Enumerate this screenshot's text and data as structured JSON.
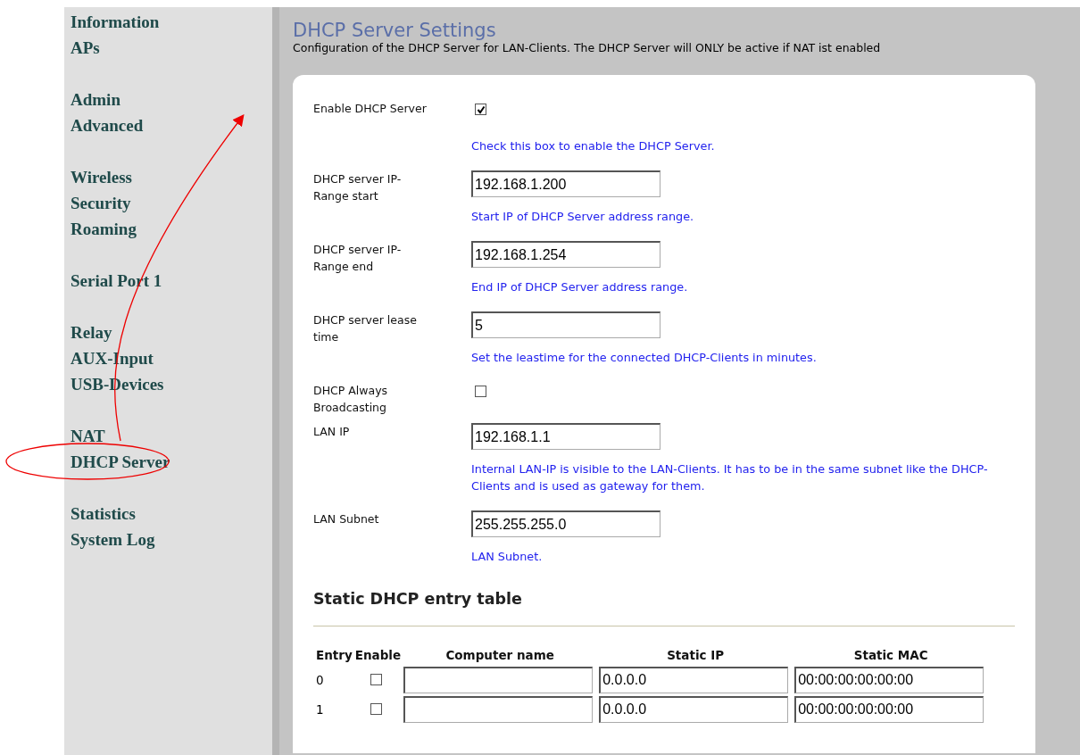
{
  "sidebar": {
    "groups": [
      {
        "items": [
          {
            "label": "Information"
          },
          {
            "label": "APs"
          }
        ]
      },
      {
        "items": [
          {
            "label": "Admin"
          },
          {
            "label": "Advanced"
          }
        ]
      },
      {
        "items": [
          {
            "label": "Wireless"
          },
          {
            "label": "Security"
          },
          {
            "label": "Roaming"
          }
        ]
      },
      {
        "items": [
          {
            "label": "Serial Port 1"
          }
        ]
      },
      {
        "items": [
          {
            "label": "Relay"
          },
          {
            "label": "AUX-Input"
          },
          {
            "label": "USB-Devices"
          }
        ]
      },
      {
        "items": [
          {
            "label": "NAT"
          },
          {
            "label": "DHCP Server"
          }
        ]
      },
      {
        "items": [
          {
            "label": "Statistics"
          },
          {
            "label": "System Log"
          }
        ]
      }
    ]
  },
  "page": {
    "title": "DHCP Server Settings",
    "description": "Configuration of the DHCP Server for LAN-Clients. The DHCP Server will ONLY be active if NAT ist enabled"
  },
  "settings": [
    {
      "kind": "checkbox",
      "label": "Enable DHCP Server",
      "checked": true,
      "hint": "Check this box to enable the DHCP Server."
    },
    {
      "kind": "text",
      "label": "DHCP server IP-Range start",
      "value": "192.168.1.200",
      "hint": "Start IP of DHCP Server address range."
    },
    {
      "kind": "text",
      "label": "DHCP server IP-Range end",
      "value": "192.168.1.254",
      "hint": "End IP of DHCP Server address range."
    },
    {
      "kind": "text",
      "label": "DHCP server lease time",
      "value": "5",
      "hint": "Set the leastime for the connected DHCP-Clients in minutes."
    },
    {
      "kind": "checkbox",
      "label": "DHCP Always Broadcasting",
      "checked": false
    },
    {
      "kind": "text",
      "label": "LAN IP",
      "value": "192.168.1.1",
      "hint": "Internal LAN-IP is visible to the LAN-Clients. It has to be in the same subnet like the DHCP-Clients and is used as gateway for them."
    },
    {
      "kind": "text",
      "label": "LAN Subnet",
      "value": "255.255.255.0",
      "hint": "LAN Subnet."
    }
  ],
  "static_table": {
    "title": "Static DHCP entry table",
    "columns": [
      "Entry",
      "Enable",
      "Computer name",
      "Static IP",
      "Static MAC"
    ],
    "rows": [
      {
        "entry": "0",
        "enabled": false,
        "static_ip": "0.0.0.0",
        "static_mac": "00:00:00:00:00:00"
      },
      {
        "entry": "1",
        "enabled": false,
        "static_ip": "0.0.0.0",
        "static_mac": "00:00:00:00:00:00"
      }
    ]
  }
}
